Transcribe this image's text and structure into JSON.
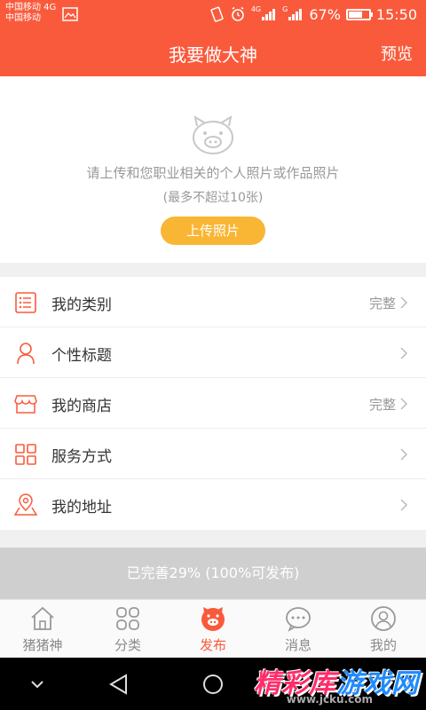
{
  "status_bar": {
    "carrier1": "中国移动 4G",
    "carrier2": "中国移动",
    "signal_tag1": "4G",
    "signal_tag2": "G",
    "battery": "67%",
    "time": "15:50"
  },
  "header": {
    "title": "我要做大神",
    "preview": "预览"
  },
  "upload": {
    "hint": "请上传和您职业相关的个人照片或作品照片",
    "limit": "(最多不超过10张)",
    "button": "上传照片"
  },
  "menu": [
    {
      "label": "我的类别",
      "status": "完整",
      "icon": "list-icon"
    },
    {
      "label": "个性标题",
      "status": "",
      "icon": "person-icon"
    },
    {
      "label": "我的商店",
      "status": "完整",
      "icon": "shop-icon"
    },
    {
      "label": "服务方式",
      "status": "",
      "icon": "grid-icon"
    },
    {
      "label": "我的地址",
      "status": "",
      "icon": "location-icon"
    }
  ],
  "progress_text": "已完善29% (100%可发布)",
  "progress_value": 0.29,
  "tabs": [
    {
      "label": "猪猪神",
      "icon": "home-icon"
    },
    {
      "label": "分类",
      "icon": "category-icon"
    },
    {
      "label": "发布",
      "icon": "publish-pig-icon",
      "active": true
    },
    {
      "label": "消息",
      "icon": "message-icon"
    },
    {
      "label": "我的",
      "icon": "profile-icon"
    }
  ],
  "watermark": {
    "part1": "精彩库",
    "part2": "游戏网",
    "url": "www.jcku.com"
  },
  "colors": {
    "accent": "#fa5a3c",
    "button": "#f9b534",
    "progress_bg": "#cfcfcf"
  }
}
